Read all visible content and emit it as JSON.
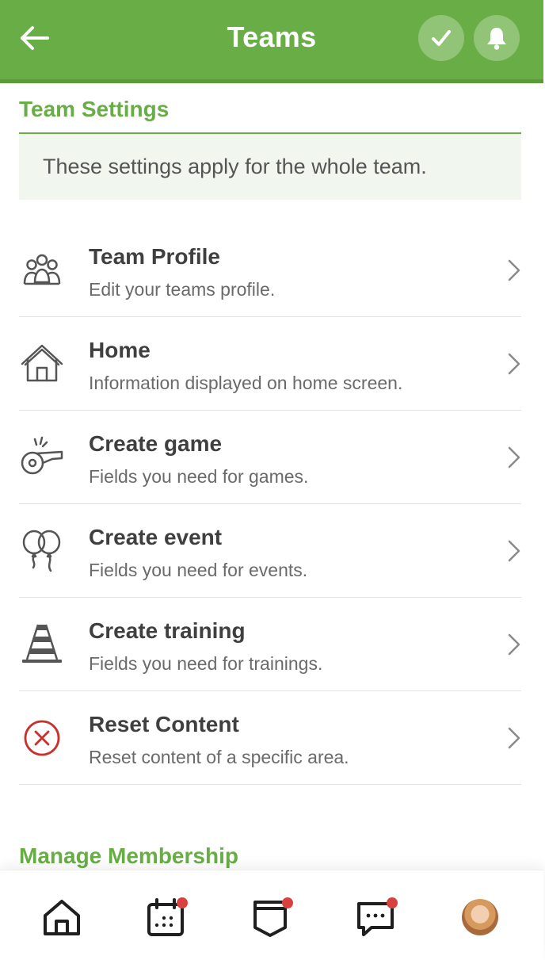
{
  "header": {
    "title": "Teams",
    "back_icon": "arrow-left-icon",
    "actions": [
      "check-icon",
      "bell-icon"
    ]
  },
  "team_settings": {
    "title": "Team Settings",
    "info": "These settings apply for the whole team."
  },
  "menu": [
    {
      "icon": "team-group-icon",
      "title": "Team Profile",
      "subtitle": "Edit your teams profile."
    },
    {
      "icon": "home-icon",
      "title": "Home",
      "subtitle": "Information displayed on home screen."
    },
    {
      "icon": "whistle-icon",
      "title": "Create game",
      "subtitle": "Fields you need for games."
    },
    {
      "icon": "balloons-icon",
      "title": "Create event",
      "subtitle": "Fields you need for events."
    },
    {
      "icon": "training-cone-icon",
      "title": "Create training",
      "subtitle": "Fields you need for trainings."
    },
    {
      "icon": "reset-x-icon",
      "title": "Reset Content",
      "subtitle": "Reset content of a specific area."
    }
  ],
  "manage_membership": {
    "title": "Manage Membership"
  },
  "bottom_nav": [
    "home-icon",
    "calendar-icon",
    "board-icon",
    "chat-icon",
    "avatar"
  ],
  "colors": {
    "brand_green": "#68ad45",
    "notification_red": "#d94141",
    "reset_red": "#c9302c"
  }
}
